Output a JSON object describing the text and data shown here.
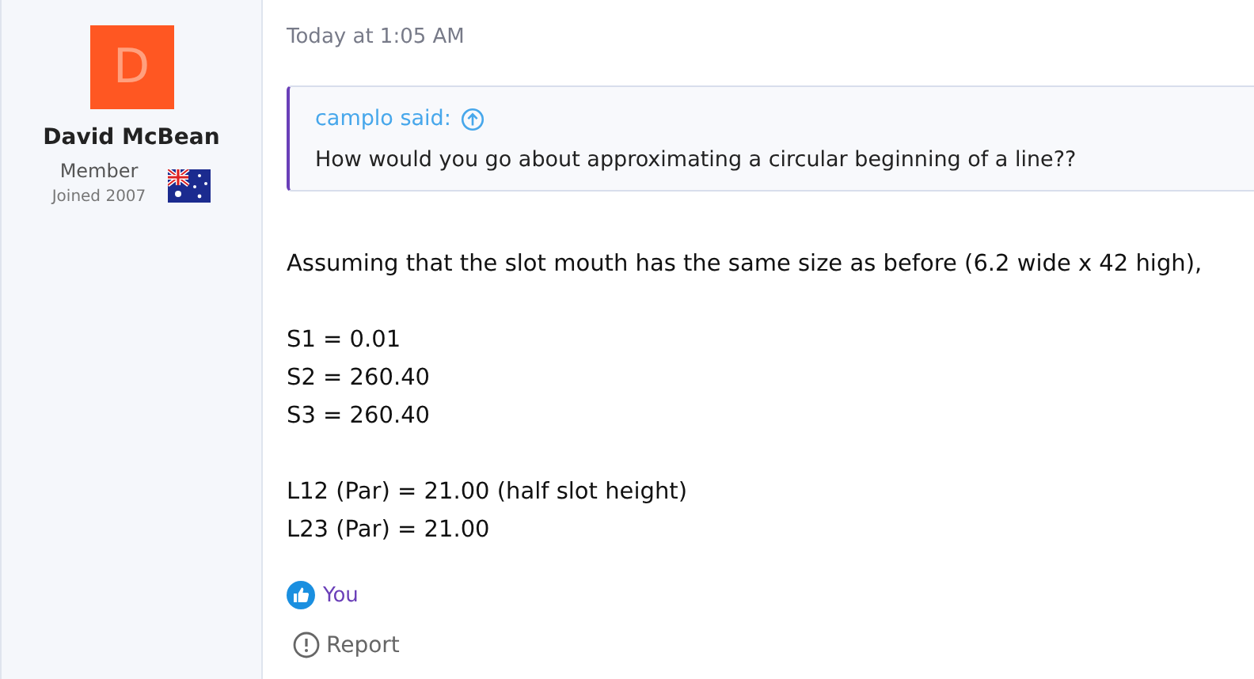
{
  "author": {
    "avatar_letter": "D",
    "name": "David McBean",
    "role": "Member",
    "joined": "Joined 2007"
  },
  "post": {
    "time": "Today at 1:05 AM",
    "quote": {
      "attribution": "camplo said:",
      "text": "How would you go about approximating a circular beginning of a line??"
    },
    "paragraphs": [
      [
        "Assuming that the slot mouth has the same size as before (6.2 wide x 42 high),"
      ],
      [
        "S1 = 0.01",
        "S2 = 260.40",
        "S3 = 260.40"
      ],
      [
        "L12 (Par) = 21.00 (half slot height)",
        "L23 (Par) = 21.00"
      ]
    ],
    "reaction": "You",
    "report": "Report"
  }
}
